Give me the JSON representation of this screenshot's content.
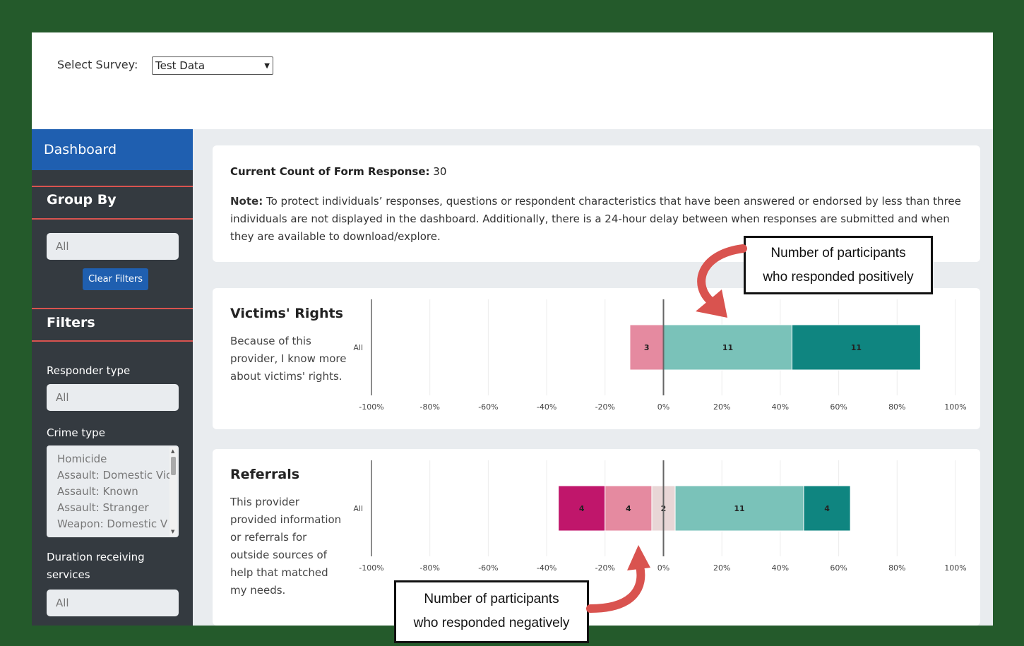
{
  "survey": {
    "label": "Select Survey:",
    "selected": "Test Data"
  },
  "sidebar": {
    "dashboard": "Dashboard",
    "group_by": "Group By",
    "group_by_value": "All",
    "clear_filters": "Clear Filters",
    "filters": "Filters",
    "responder_type_label": "Responder type",
    "responder_type_value": "All",
    "crime_type_label": "Crime type",
    "crime_type_options": [
      "Homicide",
      "Assault: Domestic Vic",
      "Assault: Known",
      "Assault: Stranger",
      "Weapon: Domestic V"
    ],
    "duration_label": "Duration receiving services",
    "duration_value": "All"
  },
  "info": {
    "count_label": "Current Count of Form Response:",
    "count_value": "30",
    "note_label": "Note:",
    "note_text": "To protect individuals’ responses, questions or respondent characteristics that have been answered or endorsed by less than three individuals are not displayed in the dashboard. Additionally, there is a 24-hour delay between when responses are submitted and when they are available to download/explore."
  },
  "charts": [
    {
      "title": "Victims' Rights",
      "description": "Because of this provider, I know more about victims' rights."
    },
    {
      "title": "Referrals",
      "description": "This provider provided information or referrals for outside sources of help that matched my needs."
    }
  ],
  "callouts": {
    "positive_line1": "Number of participants",
    "positive_line2": "who responded positively",
    "negative_line1": "Number of participants",
    "negative_line2": "who responded negatively"
  },
  "colors": {
    "strong_negative": "#c0166b",
    "negative": "#e58aa0",
    "neutral": "#e8d6d6",
    "positive": "#7ac2b9",
    "strong_positive": "#0f8580",
    "arrow": "#d9534f"
  },
  "chart_data": [
    {
      "type": "bar",
      "orientation": "horizontal-diverging",
      "title": "Victims' Rights",
      "categories": [
        "All"
      ],
      "x_ticks": [
        "-100%",
        "-80%",
        "-60%",
        "-40%",
        "-20%",
        "0%",
        "20%",
        "40%",
        "60%",
        "80%",
        "100%"
      ],
      "xlim": [
        -100,
        100
      ],
      "series": [
        {
          "category": "negative",
          "label": "3",
          "start": -11.5,
          "end": 0
        },
        {
          "category": "positive",
          "label": "11",
          "start": 0,
          "end": 44
        },
        {
          "category": "strong_positive",
          "label": "11",
          "start": 44,
          "end": 88
        }
      ]
    },
    {
      "type": "bar",
      "orientation": "horizontal-diverging",
      "title": "Referrals",
      "categories": [
        "All"
      ],
      "x_ticks": [
        "-100%",
        "-80%",
        "-60%",
        "-40%",
        "-20%",
        "0%",
        "20%",
        "40%",
        "60%",
        "80%",
        "100%"
      ],
      "xlim": [
        -100,
        100
      ],
      "series": [
        {
          "category": "strong_negative",
          "label": "4",
          "start": -36,
          "end": -20
        },
        {
          "category": "negative",
          "label": "4",
          "start": -20,
          "end": -4
        },
        {
          "category": "neutral",
          "label": "2",
          "start": -4,
          "end": 4
        },
        {
          "category": "positive",
          "label": "11",
          "start": 4,
          "end": 48
        },
        {
          "category": "strong_positive",
          "label": "4",
          "start": 48,
          "end": 64
        }
      ]
    }
  ]
}
